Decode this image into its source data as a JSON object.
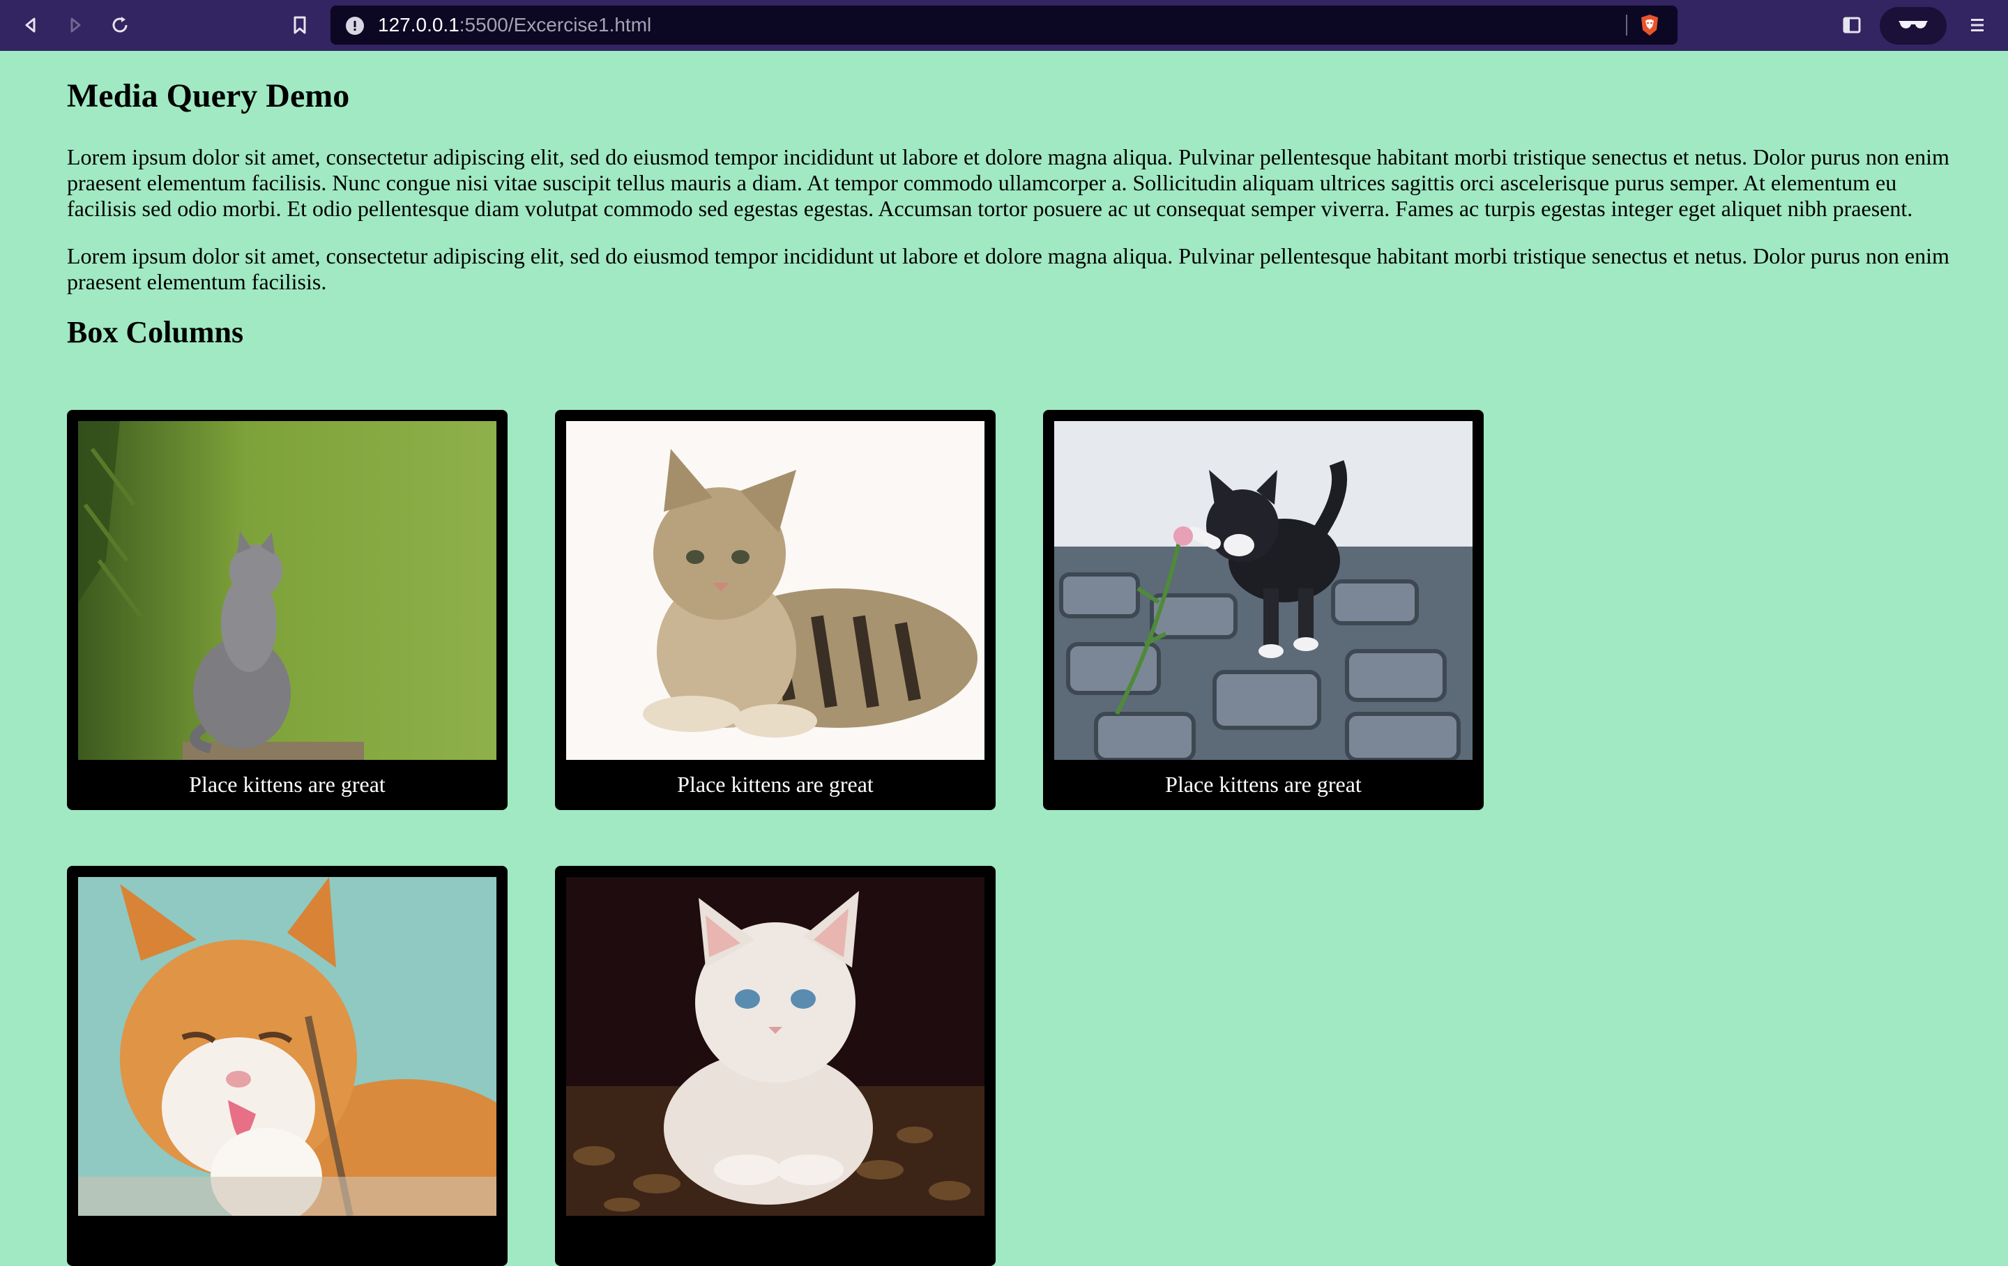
{
  "browser": {
    "url_host": "127.0.0.1",
    "url_rest": ":5500/Excercise1.html",
    "toolbar_color": "#332462",
    "icons": {
      "back": "back-icon",
      "forward": "forward-icon",
      "reload": "reload-icon",
      "bookmark": "bookmark-icon",
      "site_info": "info-icon",
      "shields": "brave-shield-icon",
      "sidebar": "sidebar-icon",
      "reader": "reader-mode-icon",
      "menu": "menu-icon"
    }
  },
  "page": {
    "background": "#a0e9c3",
    "title": "Media Query Demo",
    "paragraphs": [
      "Lorem ipsum dolor sit amet, consectetur adipiscing elit, sed do eiusmod tempor incididunt ut labore et dolore magna aliqua. Pulvinar pellentesque habitant morbi tristique senectus et netus. Dolor purus non enim praesent elementum facilisis. Nunc congue nisi vitae suscipit tellus mauris a diam. At tempor commodo ullamcorper a. Sollicitudin aliquam ultrices sagittis orci ascelerisque purus semper. At elementum eu facilisis sed odio morbi. Et odio pellentesque diam volutpat commodo sed egestas egestas. Accumsan tortor posuere ac ut consequat semper viverra. Fames ac turpis egestas integer eget aliquet nibh praesent.",
      "Lorem ipsum dolor sit amet, consectetur adipiscing elit, sed do eiusmod tempor incididunt ut labore et dolore magna aliqua. Pulvinar pellentesque habitant morbi tristique senectus et netus. Dolor purus non enim praesent elementum facilisis."
    ],
    "section_title": "Box Columns",
    "cards": [
      {
        "photo": "grey kitten sitting in grass looking up",
        "caption": "Place kittens are great"
      },
      {
        "photo": "tabby kitten lying on white background",
        "caption": "Place kittens are great"
      },
      {
        "photo": "black and white kitten pawing a flower on cobblestones",
        "caption": "Place kittens are great"
      },
      {
        "photo": "orange and white cat licking its paw",
        "caption": ""
      },
      {
        "photo": "white kitten looking up in a basket",
        "caption": ""
      }
    ]
  }
}
